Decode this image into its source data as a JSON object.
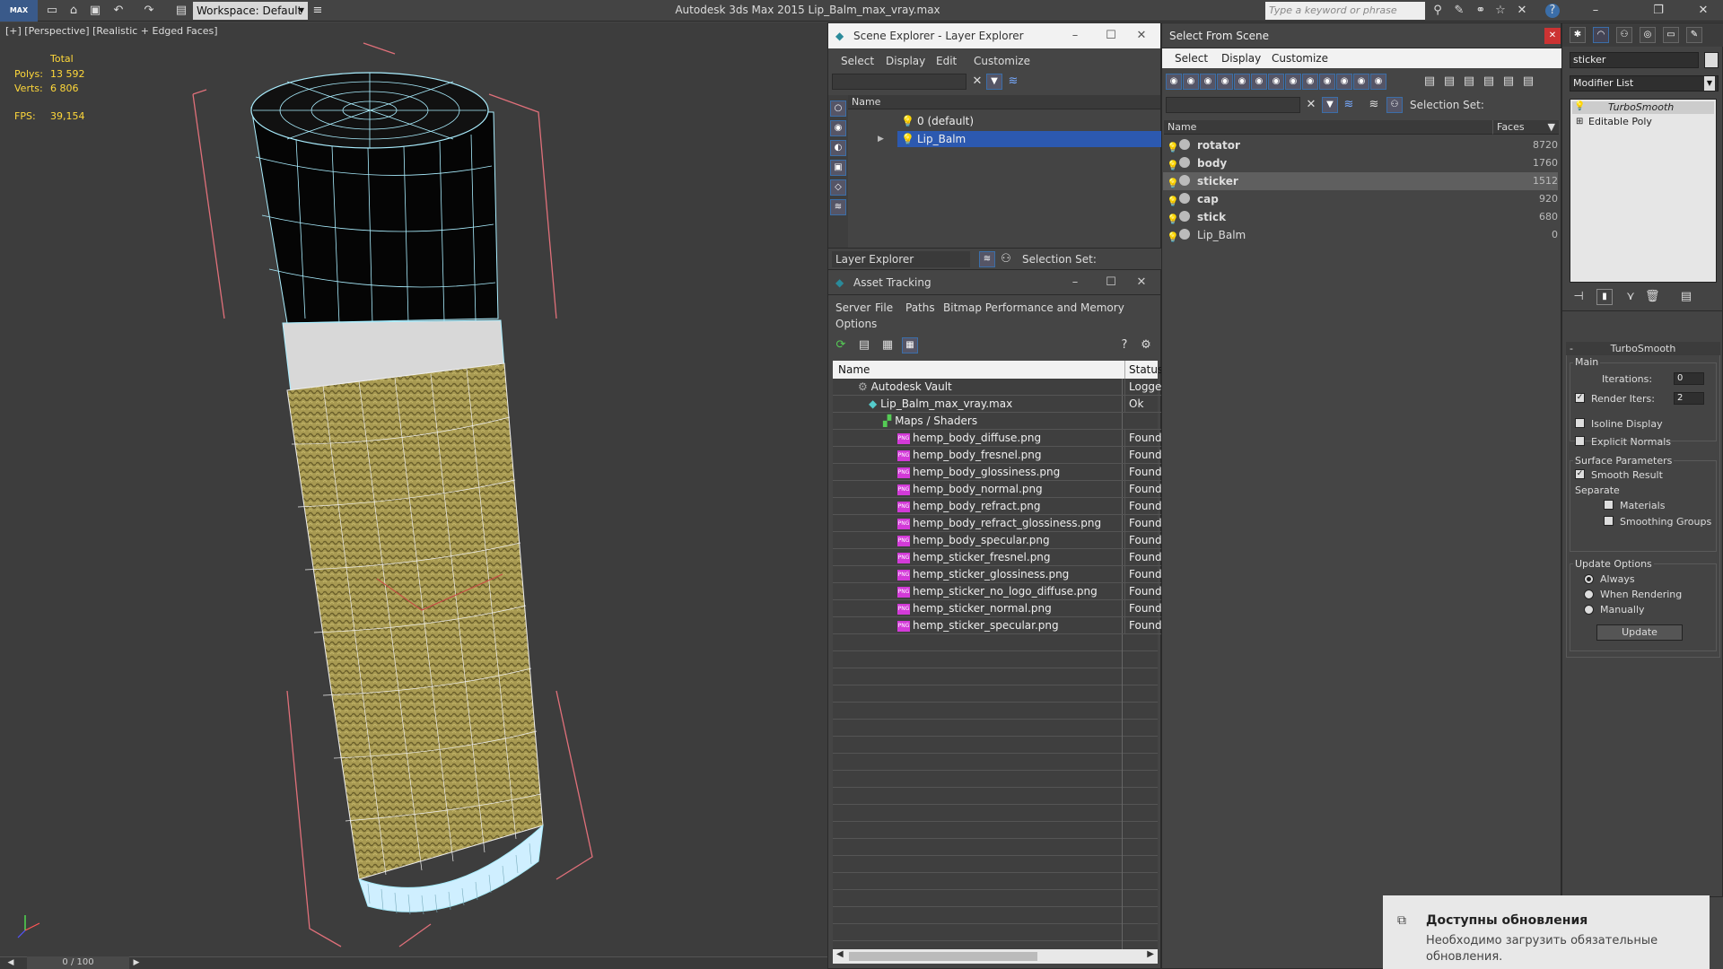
{
  "app": {
    "title": "Autodesk 3ds Max  2015    Lip_Balm_max_vray.max",
    "workspace": "Workspace: Default",
    "search_placeholder": "Type a keyword or phrase",
    "logo": "MAX"
  },
  "viewport": {
    "label": "[+] [Perspective] [Realistic + Edged Faces]",
    "total": "Total",
    "polys_label": "Polys:",
    "polys": "13 592",
    "verts_label": "Verts:",
    "verts": "6 806",
    "fps_label": "FPS:",
    "fps": "39,154",
    "frame": "0 / 100"
  },
  "scene_explorer": {
    "title": "Scene Explorer - Layer Explorer",
    "menu": [
      "Select",
      "Display",
      "Edit",
      "Customize"
    ],
    "col_name": "Name",
    "rows": [
      "0 (default)",
      "Lip_Balm"
    ],
    "footer": "Layer Explorer",
    "selection_set": "Selection Set:"
  },
  "select_from_scene": {
    "title": "Select From Scene",
    "menu": [
      "Select",
      "Display",
      "Customize"
    ],
    "selection_set": "Selection Set:",
    "col_name": "Name",
    "col_faces": "Faces",
    "rows": [
      {
        "name": "rotator",
        "faces": "8720"
      },
      {
        "name": "body",
        "faces": "1760"
      },
      {
        "name": "sticker",
        "faces": "1512"
      },
      {
        "name": "cap",
        "faces": "920"
      },
      {
        "name": "stick",
        "faces": "680"
      },
      {
        "name": "Lip_Balm",
        "faces": "0"
      }
    ]
  },
  "asset_tracking": {
    "title": "Asset Tracking",
    "menu": [
      "Server",
      "File",
      "Paths",
      "Bitmap Performance and Memory",
      "Options"
    ],
    "col_name": "Name",
    "col_status": "Status",
    "rows": [
      {
        "name": "Autodesk Vault",
        "status": "Logged"
      },
      {
        "name": "Lip_Balm_max_vray.max",
        "status": "Ok"
      },
      {
        "name": "Maps / Shaders",
        "status": ""
      },
      {
        "name": "hemp_body_diffuse.png",
        "status": "Found"
      },
      {
        "name": "hemp_body_fresnel.png",
        "status": "Found"
      },
      {
        "name": "hemp_body_glossiness.png",
        "status": "Found"
      },
      {
        "name": "hemp_body_normal.png",
        "status": "Found"
      },
      {
        "name": "hemp_body_refract.png",
        "status": "Found"
      },
      {
        "name": "hemp_body_refract_glossiness.png",
        "status": "Found"
      },
      {
        "name": "hemp_body_specular.png",
        "status": "Found"
      },
      {
        "name": "hemp_sticker_fresnel.png",
        "status": "Found"
      },
      {
        "name": "hemp_sticker_glossiness.png",
        "status": "Found"
      },
      {
        "name": "hemp_sticker_no_logo_diffuse.png",
        "status": "Found"
      },
      {
        "name": "hemp_sticker_normal.png",
        "status": "Found"
      },
      {
        "name": "hemp_sticker_specular.png",
        "status": "Found"
      }
    ]
  },
  "modify": {
    "object_name": "sticker",
    "modifier_list": "Modifier List",
    "stack": [
      "TurboSmooth",
      "Editable Poly"
    ],
    "rollout": "TurboSmooth",
    "main": "Main",
    "iterations_label": "Iterations:",
    "iterations": "0",
    "render_iters_label": "Render Iters:",
    "render_iters": "2",
    "isoline": "Isoline Display",
    "explicit": "Explicit Normals",
    "surface": "Surface Parameters",
    "smooth": "Smooth Result",
    "separate": "Separate",
    "materials": "Materials",
    "smoothing": "Smoothing Groups",
    "update_options": "Update Options",
    "always": "Always",
    "when_rendering": "When Rendering",
    "manually": "Manually",
    "update_btn": "Update"
  },
  "notification": {
    "title": "Доступны обновления",
    "body": "Необходимо загрузить обязательные обновления."
  },
  "colors": {
    "selection": "#2c59b0",
    "accent": "#3b6ea8"
  }
}
